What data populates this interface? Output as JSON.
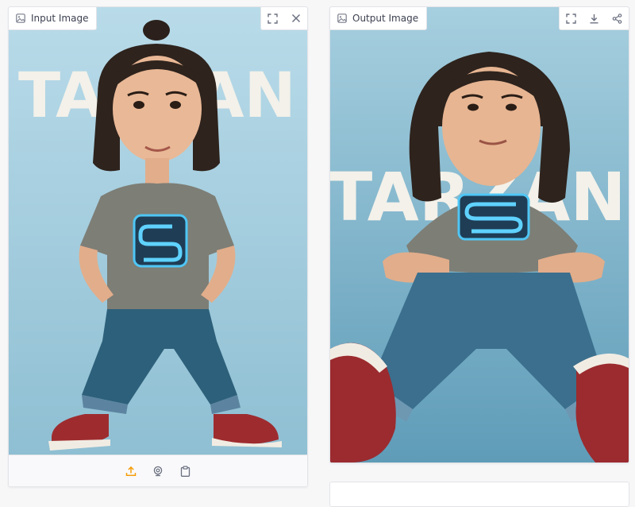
{
  "input_panel": {
    "label": "Input Image",
    "actions": [
      "fullscreen-icon",
      "close-icon"
    ],
    "bottom_toolbar": [
      "upload-icon",
      "webcam-icon",
      "clipboard-icon"
    ],
    "backdrop_text": "TARZAN"
  },
  "output_panel": {
    "label": "Output Image",
    "actions": [
      "fullscreen-icon",
      "download-icon",
      "share-icon"
    ],
    "backdrop_text": "TARZAN"
  },
  "colors": {
    "backdrop": "#a9cfdf",
    "upload_accent": "#f59e0b",
    "icon": "#6b7080",
    "border": "#e3e4e8"
  }
}
